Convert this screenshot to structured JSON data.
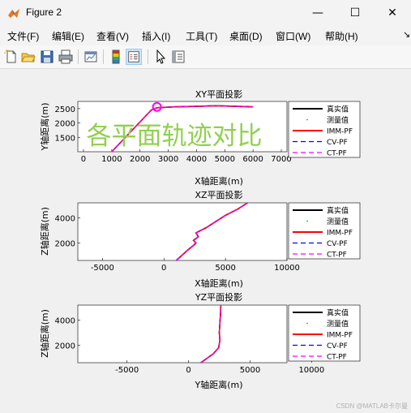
{
  "window": {
    "title": "Figure 2",
    "minimize_glyph": "—",
    "maximize_glyph": "☐",
    "close_glyph": "✕"
  },
  "menubar": {
    "items": [
      "文件(F)",
      "编辑(E)",
      "查看(V)",
      "插入(I)",
      "工具(T)",
      "桌面(D)",
      "窗口(W)",
      "帮助(H)"
    ]
  },
  "toolbar": {
    "icons": [
      "new-figure-icon",
      "open-file-icon",
      "save-icon",
      "print-icon",
      "link-plot-icon",
      "insert-colorbar-icon",
      "insert-legend-icon",
      "edit-plot-icon",
      "property-inspector-icon"
    ]
  },
  "overlay_text": "各平面轨迹对比",
  "legend_entries": [
    "真实值",
    "测量值",
    "IMM-PF",
    "CV-PF",
    "CT-PF"
  ],
  "watermark": "CSDN @MATLAB卡尔曼",
  "colors": {
    "true": "#000000",
    "measured": "#00c800",
    "imm": "#ff0000",
    "cv": "#0000ff",
    "ct": "#ff00ff",
    "overlay": "#92d050"
  },
  "chart_data": [
    {
      "type": "line",
      "title": "XY平面投影",
      "xlabel": "X轴距离(m)",
      "ylabel": "Y轴距离(m)",
      "xlim": [
        -200,
        7200
      ],
      "ylim": [
        1000,
        2750
      ],
      "xticks": [
        0,
        1000,
        2000,
        3000,
        4000,
        5000,
        6000,
        7000
      ],
      "yticks": [
        1500,
        2000,
        2500
      ],
      "x": [
        1000,
        2400,
        2600,
        3200,
        4000,
        4700,
        5400,
        6000
      ],
      "y": [
        1000,
        2450,
        2530,
        2560,
        2580,
        2600,
        2580,
        2560
      ],
      "start_marker": [
        2600,
        2560
      ],
      "grid": false,
      "legend": "right"
    },
    {
      "type": "line",
      "title": "XZ平面投影",
      "xlabel": "X轴距离(m)",
      "ylabel": "Z轴距离(m)",
      "xlim": [
        -7000,
        10000
      ],
      "ylim": [
        600,
        5200
      ],
      "xticks": [
        -5000,
        0,
        5000,
        10000
      ],
      "yticks": [
        2000,
        4000
      ],
      "x": [
        1000,
        1900,
        2400,
        2600,
        2400,
        2800,
        2600,
        3400,
        4200,
        5000,
        6000,
        6800
      ],
      "y": [
        600,
        1400,
        1800,
        2000,
        2200,
        2500,
        2800,
        3200,
        3700,
        4200,
        4700,
        5200
      ],
      "grid": false,
      "legend": "right"
    },
    {
      "type": "line",
      "title": "YZ平面投影",
      "xlabel": "Y轴距离(m)",
      "ylabel": "Z轴距离(m)",
      "xlim": [
        -9000,
        8000
      ],
      "ylim": [
        600,
        5200
      ],
      "xticks": [
        -5000,
        0,
        5000,
        10000
      ],
      "yticks": [
        2000,
        4000
      ],
      "x": [
        1000,
        2000,
        2450,
        2550,
        2500,
        2550,
        2600,
        2620
      ],
      "y": [
        600,
        1300,
        1800,
        2400,
        3000,
        3800,
        4500,
        5200
      ],
      "grid": false,
      "legend": "right"
    }
  ]
}
